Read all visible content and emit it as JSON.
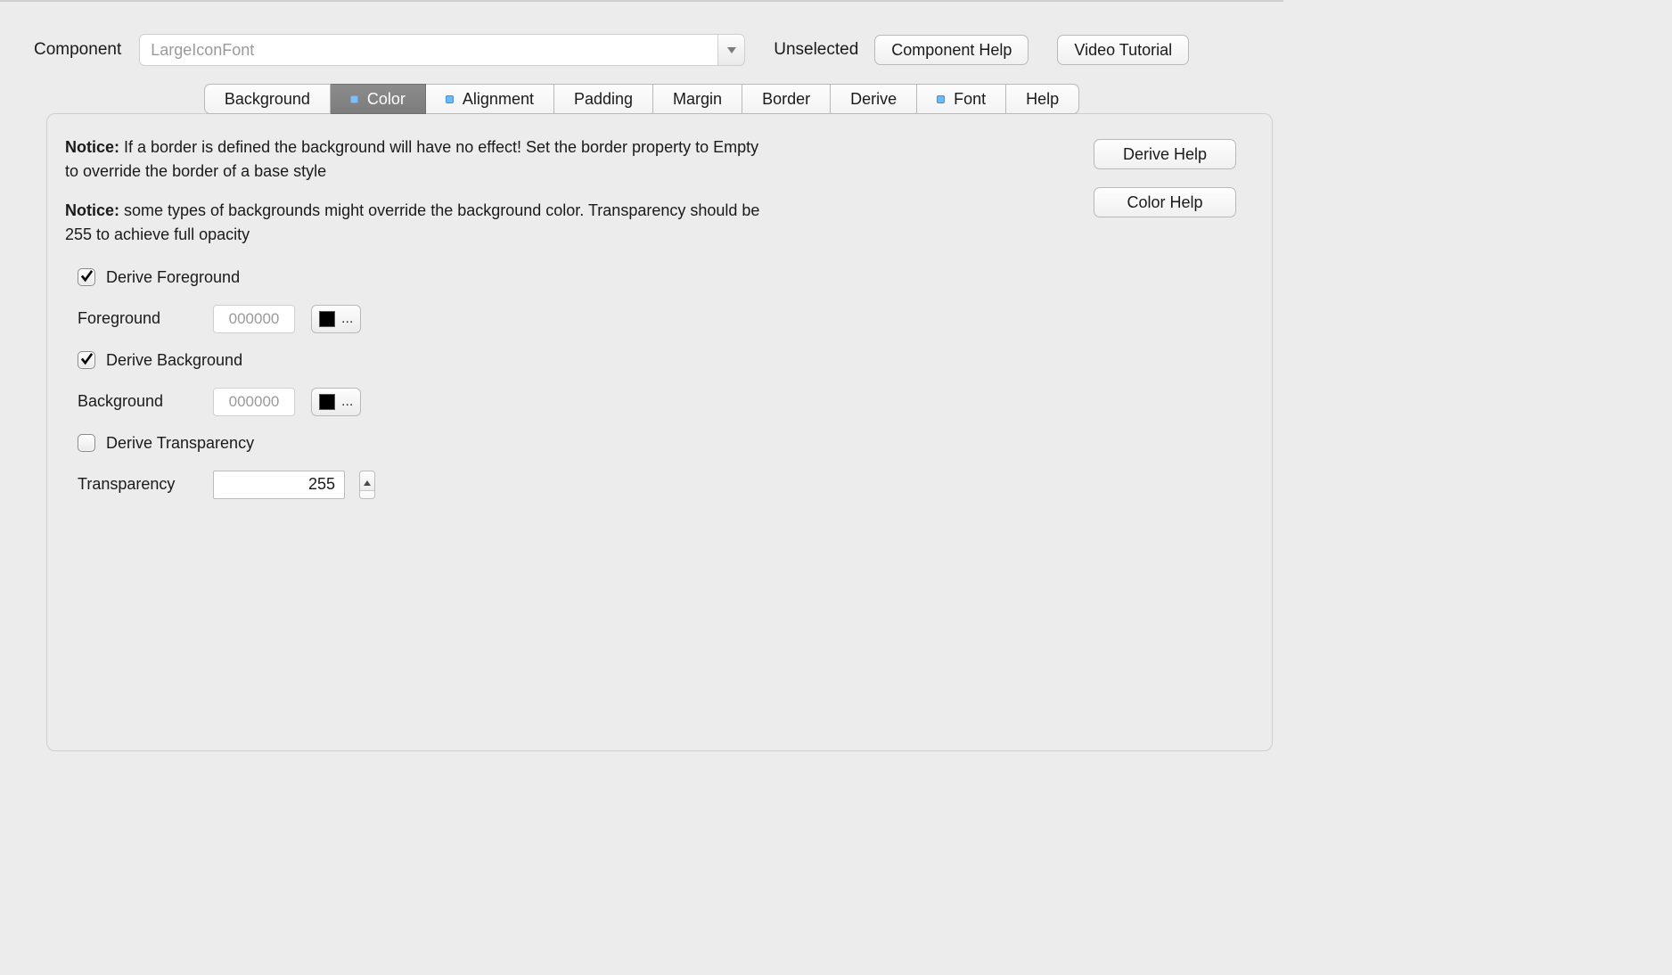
{
  "header": {
    "component_label": "Component",
    "component_value": "LargeIconFont",
    "state_text": "Unselected",
    "component_help_btn": "Component Help",
    "video_tutorial_btn": "Video Tutorial"
  },
  "tabs": {
    "background": "Background",
    "color": "Color",
    "alignment": "Alignment",
    "padding": "Padding",
    "margin": "Margin",
    "border": "Border",
    "derive": "Derive",
    "font": "Font",
    "help": "Help"
  },
  "sidebuttons": {
    "derive_help": "Derive Help",
    "color_help": "Color Help"
  },
  "notices": {
    "prefix": "Notice:",
    "n1": " If a border is defined the background will have no effect! Set the border property to Empty to override the border of a base style",
    "n2": " some types of backgrounds might override the background color. Transparency should be 255 to achieve full opacity"
  },
  "form": {
    "derive_foreground_label": "Derive Foreground",
    "derive_foreground_checked": true,
    "foreground_label": "Foreground",
    "foreground_value": "000000",
    "foreground_swatch": "#000000",
    "picker_ellipsis": "...",
    "derive_background_label": "Derive Background",
    "derive_background_checked": true,
    "background_label": "Background",
    "background_value": "000000",
    "background_swatch": "#000000",
    "derive_transparency_label": "Derive Transparency",
    "derive_transparency_checked": false,
    "transparency_label": "Transparency",
    "transparency_value": "255"
  }
}
